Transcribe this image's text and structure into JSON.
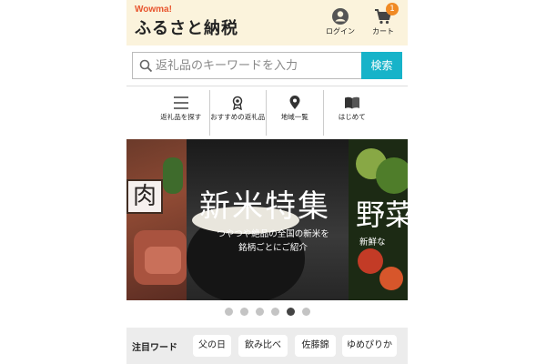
{
  "header": {
    "brand_small": "Wowma!",
    "brand_main": "ふるさと納税",
    "login_label": "ログイン",
    "cart_label": "カート",
    "cart_count": "1"
  },
  "search": {
    "placeholder": "返礼品のキーワードを入力",
    "button_label": "検索"
  },
  "nav": {
    "items": [
      {
        "label": "返礼品を探す",
        "icon": "menu-icon"
      },
      {
        "label": "おすすめの返礼品",
        "icon": "award-icon"
      },
      {
        "label": "地域一覧",
        "icon": "map-pin-icon"
      },
      {
        "label": "はじめて",
        "icon": "book-icon"
      }
    ]
  },
  "carousel": {
    "left_title": "肉",
    "main_title": "新米特集",
    "main_subtitle_line1": "つやつや絶品の全国の新米を",
    "main_subtitle_line2": "銘柄ごとにご紹介",
    "right_title": "野菜",
    "right_subtitle": "新鮮な",
    "dot_count": 6,
    "active_dot": 4
  },
  "keywords": {
    "title": "注目ワード",
    "chips": [
      "父の日",
      "飲み比べ",
      "佐藤錦",
      "ゆめぴりか"
    ]
  },
  "colors": {
    "header_bg": "#fbf3dc",
    "brand_accent": "#e8552e",
    "search_button": "#17b3c9",
    "badge": "#f08a24"
  }
}
